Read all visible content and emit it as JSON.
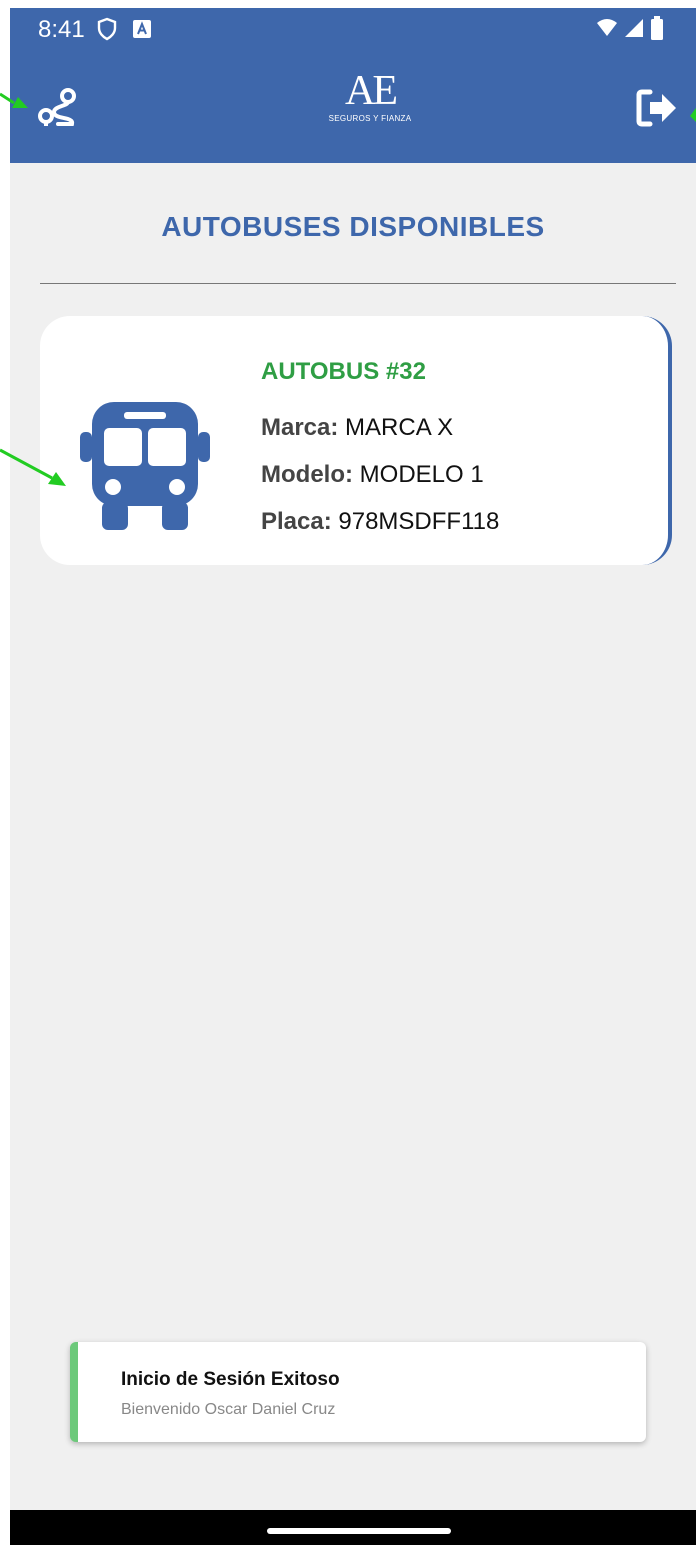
{
  "status_bar": {
    "time": "8:41"
  },
  "app_bar": {
    "logo_mark": "AE",
    "logo_subtitle": "SEGUROS Y FIANZA",
    "route_icon": "route-icon",
    "logout_icon": "logout-icon"
  },
  "page": {
    "title": "AUTOBUSES DISPONIBLES"
  },
  "bus_card": {
    "name": "AUTOBUS #32",
    "brand_label": "Marca:",
    "brand_value": "MARCA X",
    "model_label": "Modelo:",
    "model_value": "MODELO 1",
    "plate_label": "Placa:",
    "plate_value": "978MSDFF118",
    "icon": "bus-icon"
  },
  "toast": {
    "title": "Inicio de Sesión Exitoso",
    "message": "Bienvenido Oscar Daniel Cruz"
  },
  "colors": {
    "primary": "#3e67ab",
    "accent_green": "#2f9e44",
    "toast_accent": "#6cc97a",
    "background": "#f0f0f0"
  }
}
